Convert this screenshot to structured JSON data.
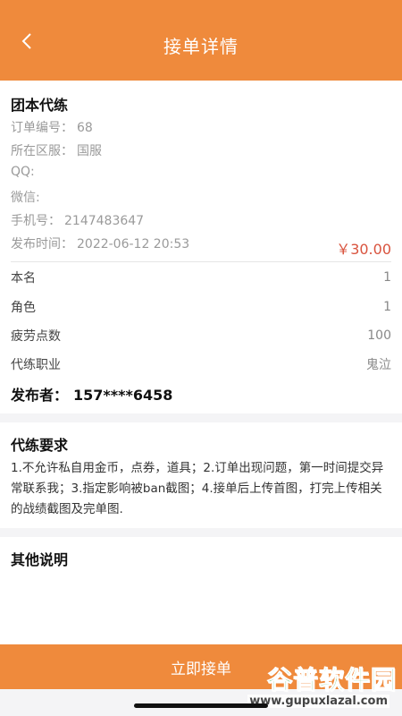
{
  "header": {
    "title": "接单详情"
  },
  "order": {
    "title": "团本代练",
    "fields": [
      {
        "label": "订单编号：",
        "value": "68"
      },
      {
        "label": "所在区服：",
        "value": "国服"
      },
      {
        "label": "QQ:",
        "value": ""
      },
      {
        "label": "微信:",
        "value": ""
      },
      {
        "label": "手机号：",
        "value": "2147483647"
      },
      {
        "label": "发布时间：",
        "value": "2022-06-12 20:53"
      }
    ],
    "price": "￥30.00",
    "rows": [
      {
        "key": "本名",
        "value": "1"
      },
      {
        "key": "角色",
        "value": "1"
      },
      {
        "key": "疲劳点数",
        "value": "100"
      },
      {
        "key": "代练职业",
        "value": "鬼泣"
      }
    ],
    "publisher_label": "发布者：",
    "publisher_value": "157****6458"
  },
  "requirements": {
    "title": "代练要求",
    "text": "1.不允许私自用金币，点券，道具；2.订单出现问题，第一时间提交异常联系我；3.指定影响被ban截图；4.接单后上传首图，打完上传相关的战绩截图及完单图."
  },
  "other": {
    "title": "其他说明"
  },
  "action": {
    "label": "立即接单"
  },
  "watermark": {
    "text": "谷普软件园",
    "url": "www.gupuxlazal.com"
  }
}
